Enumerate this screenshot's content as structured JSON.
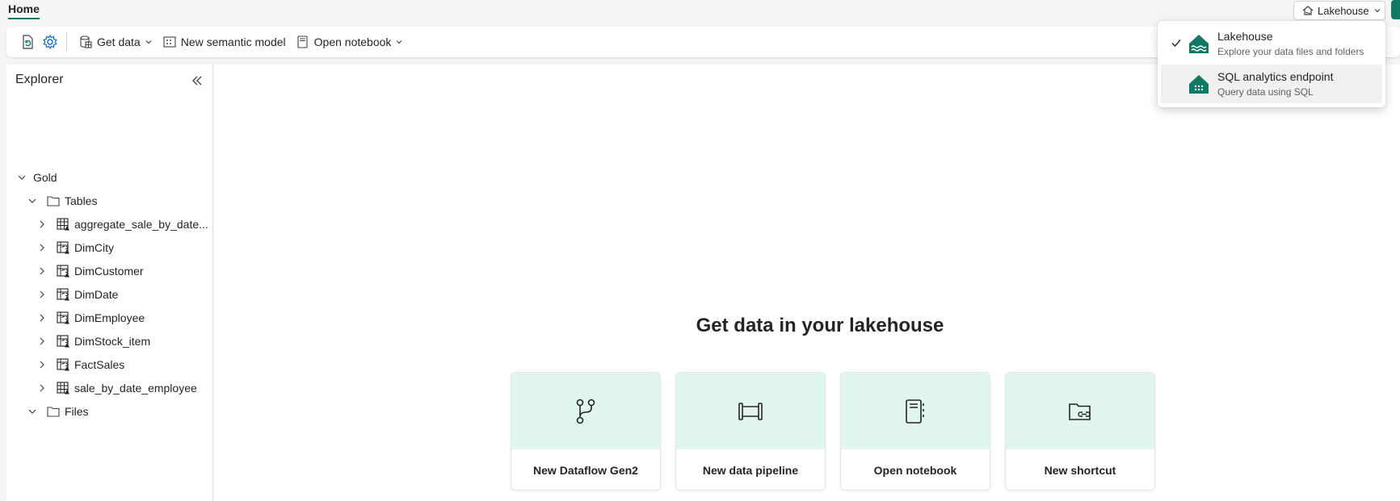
{
  "header": {
    "home_tab": "Home",
    "mode_switch_label": "Lakehouse"
  },
  "toolbar": {
    "get_data": "Get data",
    "new_semantic_model": "New semantic model",
    "open_notebook": "Open notebook"
  },
  "explorer": {
    "title": "Explorer",
    "root": "Gold",
    "tables_folder": "Tables",
    "tables": [
      {
        "name": "aggregate_sale_by_date...",
        "icon": "table-icon"
      },
      {
        "name": "DimCity",
        "icon": "linked-table-icon"
      },
      {
        "name": "DimCustomer",
        "icon": "linked-table-icon"
      },
      {
        "name": "DimDate",
        "icon": "linked-table-icon"
      },
      {
        "name": "DimEmployee",
        "icon": "linked-table-icon"
      },
      {
        "name": "DimStock_item",
        "icon": "linked-table-icon"
      },
      {
        "name": "FactSales",
        "icon": "linked-table-icon"
      },
      {
        "name": "sale_by_date_employee",
        "icon": "table-icon"
      }
    ],
    "files_folder": "Files"
  },
  "main": {
    "heading": "Get data in your lakehouse",
    "cards": [
      {
        "label": "New Dataflow Gen2",
        "icon": "dataflow-icon"
      },
      {
        "label": "New data pipeline",
        "icon": "pipeline-icon"
      },
      {
        "label": "Open notebook",
        "icon": "notebook-icon"
      },
      {
        "label": "New shortcut",
        "icon": "shortcut-folder-icon"
      }
    ]
  },
  "dropdown": {
    "items": [
      {
        "title": "Lakehouse",
        "subtitle": "Explore your data files and folders",
        "selected": true
      },
      {
        "title": "SQL analytics endpoint",
        "subtitle": "Query data using SQL",
        "selected": false
      }
    ]
  },
  "colors": {
    "accent": "#117865",
    "card_tint": "#e0f5ee",
    "warning_triangle": "#242424"
  }
}
